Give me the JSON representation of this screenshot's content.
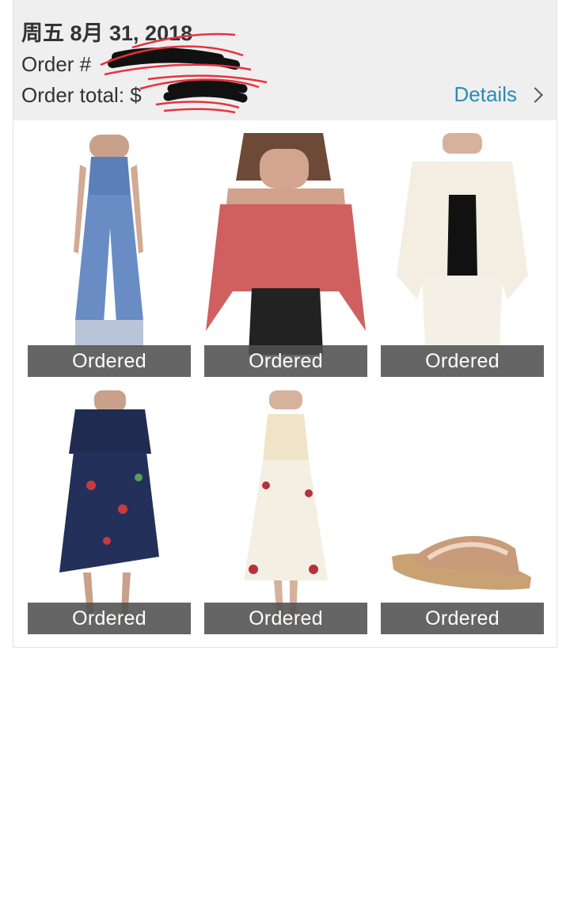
{
  "order": {
    "date": "周五 8月 31, 2018",
    "number_label": "Order #",
    "total_label": "Order total:",
    "total_currency": "$",
    "details_label": "Details"
  },
  "items": [
    {
      "name": "denim jumpsuit",
      "status": "Ordered"
    },
    {
      "name": "pink cold-shoulder top",
      "status": "Ordered"
    },
    {
      "name": "white ruffle jacket",
      "status": "Ordered"
    },
    {
      "name": "navy floral dress",
      "status": "Ordered"
    },
    {
      "name": "white embroidered dress",
      "status": "Ordered"
    },
    {
      "name": "metallic slide sandal",
      "status": "Ordered"
    }
  ],
  "colors": {
    "header_bg": "#efefef",
    "link": "#2a8bb8",
    "badge_bg": "#505050",
    "redaction": "#e8323c"
  }
}
